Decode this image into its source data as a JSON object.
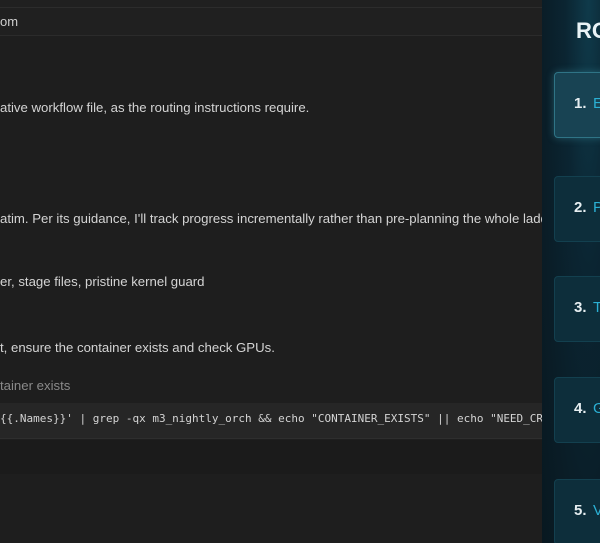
{
  "header": {
    "title": "om"
  },
  "chat": {
    "lines": [
      "ative workflow file, as the routing instructions require.",
      "atim. Per its guidance, I'll track progress incrementally rather than pre-planning the whole ladder.",
      "er, stage files, pristine kernel guard",
      "t, ensure the container exists and check GPUs.",
      "tainer exists"
    ],
    "code": "{{.Names}}' | grep -qx m3_nightly_orch && echo \"CONTAINER_EXISTS\" || echo \"NEED_CREATE\""
  },
  "panel": {
    "heading": "RO",
    "steps": [
      {
        "num": "1.",
        "label": "E",
        "active": true
      },
      {
        "num": "2.",
        "label": "P",
        "active": false
      },
      {
        "num": "3.",
        "label": "T",
        "active": false
      },
      {
        "num": "4.",
        "label": "G",
        "active": false
      },
      {
        "num": "5.",
        "label": "V",
        "active": false
      }
    ]
  }
}
